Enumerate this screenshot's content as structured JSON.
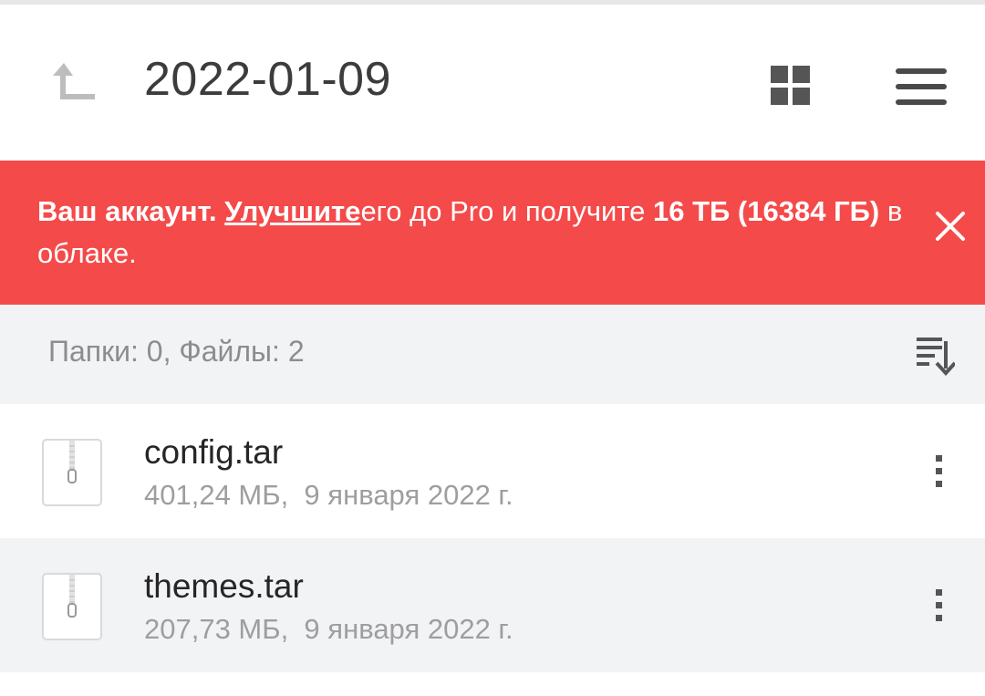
{
  "header": {
    "title": "2022-01-09",
    "up_icon": "arrow-up-left-icon",
    "grid_icon": "grid-view-icon",
    "menu_icon": "hamburger-menu-icon"
  },
  "banner": {
    "part1": "Ваш аккаунт. ",
    "link": "Улучшите",
    "part2": "его до Pro и получите ",
    "bold": "16 ТБ (16384 ГБ)",
    "part3": " в облаке.",
    "close_icon": "close-icon",
    "color": "#f44a4a"
  },
  "summary": {
    "text": "Папки: 0, Файлы: 2",
    "sort_icon": "sort-descending-icon"
  },
  "files": [
    {
      "name": "config.tar",
      "meta": "401,24 МБ,  9 января 2022 г.",
      "icon": "archive-file-icon"
    },
    {
      "name": "themes.tar",
      "meta": "207,73 МБ,  9 января 2022 г.",
      "icon": "archive-file-icon"
    }
  ]
}
